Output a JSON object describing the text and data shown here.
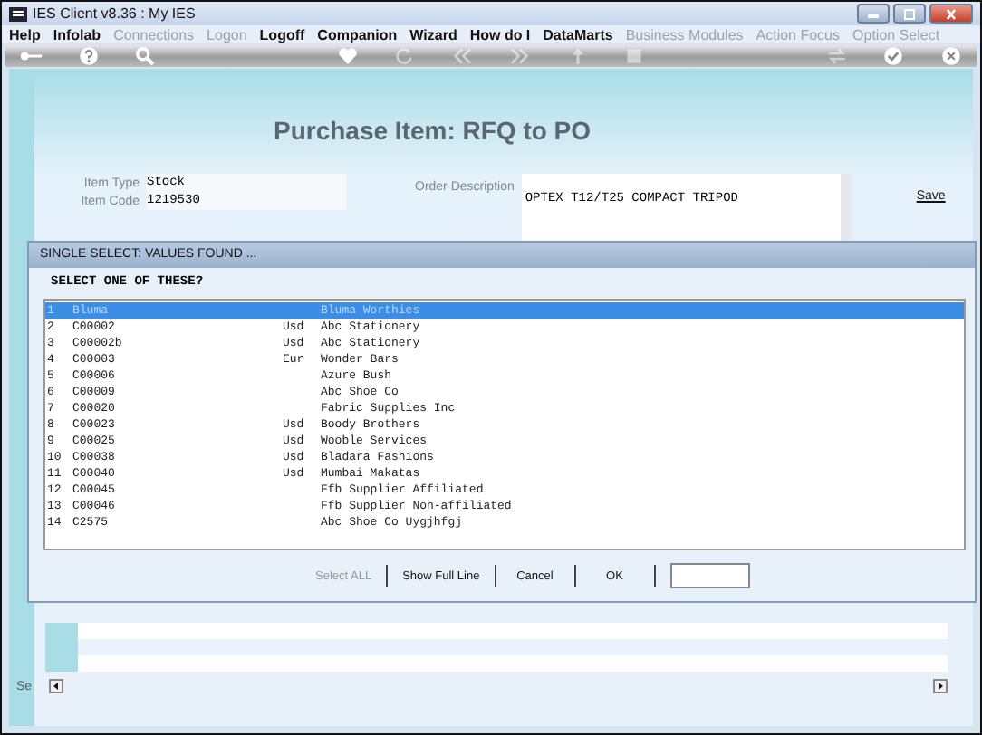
{
  "window": {
    "title": "IES Client v8.36 : My IES"
  },
  "menu": [
    {
      "label": "Help",
      "disabled": false
    },
    {
      "label": "Infolab",
      "disabled": false
    },
    {
      "label": "Connections",
      "disabled": true
    },
    {
      "label": "Logon",
      "disabled": true
    },
    {
      "label": "Logoff",
      "disabled": false
    },
    {
      "label": "Companion",
      "disabled": false
    },
    {
      "label": "Wizard",
      "disabled": false
    },
    {
      "label": "How do I",
      "disabled": false
    },
    {
      "label": "DataMarts",
      "disabled": false
    },
    {
      "label": "Business Modules",
      "disabled": true
    },
    {
      "label": "Action Focus",
      "disabled": true
    },
    {
      "label": "Option Select",
      "disabled": true
    }
  ],
  "toolbar": [
    {
      "kind": "key",
      "disabled": false
    },
    {
      "kind": "help",
      "disabled": false
    },
    {
      "kind": "search",
      "disabled": false
    },
    {
      "kind": "gap"
    },
    {
      "kind": "heart",
      "disabled": false
    },
    {
      "kind": "refresh",
      "disabled": true
    },
    {
      "kind": "back",
      "disabled": true
    },
    {
      "kind": "forward",
      "disabled": true
    },
    {
      "kind": "up",
      "disabled": true
    },
    {
      "kind": "stop",
      "disabled": true
    },
    {
      "kind": "gap"
    },
    {
      "kind": "swap",
      "disabled": true
    },
    {
      "kind": "check",
      "disabled": false
    },
    {
      "kind": "close",
      "disabled": false
    }
  ],
  "page": {
    "title": "Purchase Item: RFQ to PO",
    "fields": [
      {
        "label": "Item Type",
        "value": "Stock"
      },
      {
        "label": "Item Code",
        "value": "1219530"
      }
    ],
    "order_description": {
      "label": "Order Description",
      "value": "OPTEX T12/T25 COMPACT TRIPOD"
    },
    "save_link": "Save",
    "side_label": "Se"
  },
  "dialog": {
    "title": "SINGLE SELECT: VALUES FOUND ...",
    "prompt": "SELECT ONE OF THESE?",
    "rows": [
      {
        "number": "1",
        "code": "Bluma",
        "currency": "",
        "name": "Bluma Worthies",
        "selected": true
      },
      {
        "number": "2",
        "code": "C00002",
        "currency": "Usd",
        "name": "Abc Stationery",
        "selected": false
      },
      {
        "number": "3",
        "code": "C00002b",
        "currency": "Usd",
        "name": "Abc Stationery",
        "selected": false
      },
      {
        "number": "4",
        "code": "C00003",
        "currency": "Eur",
        "name": "Wonder Bars",
        "selected": false
      },
      {
        "number": "5",
        "code": "C00006",
        "currency": "",
        "name": "Azure Bush",
        "selected": false
      },
      {
        "number": "6",
        "code": "C00009",
        "currency": "",
        "name": "Abc Shoe Co",
        "selected": false
      },
      {
        "number": "7",
        "code": "C00020",
        "currency": "",
        "name": "Fabric Supplies Inc",
        "selected": false
      },
      {
        "number": "8",
        "code": "C00023",
        "currency": "Usd",
        "name": "Boody Brothers",
        "selected": false
      },
      {
        "number": "9",
        "code": "C00025",
        "currency": "Usd",
        "name": "Wooble Services",
        "selected": false
      },
      {
        "number": "10",
        "code": "C00038",
        "currency": "Usd",
        "name": "Bladara Fashions",
        "selected": false
      },
      {
        "number": "11",
        "code": "C00040",
        "currency": "Usd",
        "name": "Mumbai Makatas",
        "selected": false
      },
      {
        "number": "12",
        "code": "C00045",
        "currency": "",
        "name": "Ffb Supplier Affiliated",
        "selected": false
      },
      {
        "number": "13",
        "code": "C00046",
        "currency": "",
        "name": "Ffb Supplier Non-affiliated",
        "selected": false
      },
      {
        "number": "14",
        "code": "C2575",
        "currency": "",
        "name": "Abc Shoe Co Uygjhfgj",
        "selected": false
      }
    ],
    "buttons": [
      {
        "label": "Select ALL",
        "disabled": true
      },
      {
        "label": "Show Full Line",
        "disabled": false
      },
      {
        "label": "Cancel",
        "disabled": false
      },
      {
        "label": "OK",
        "disabled": false
      }
    ]
  }
}
